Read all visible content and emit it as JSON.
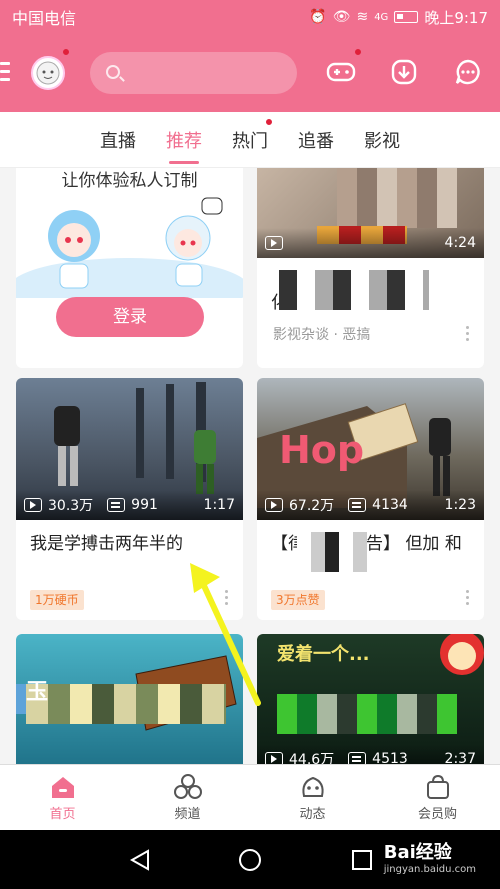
{
  "status_bar": {
    "carrier": "中国电信",
    "signal": "4G",
    "time": "晚上9:17"
  },
  "header": {
    "search_placeholder": "",
    "accent_color": "#f16f8f",
    "icons": [
      "menu-icon",
      "avatar",
      "search-icon",
      "game-icon",
      "download-icon",
      "message-icon"
    ]
  },
  "tabs": [
    {
      "label": "直播",
      "active": false
    },
    {
      "label": "推荐",
      "active": true
    },
    {
      "label": "热门",
      "active": false
    },
    {
      "label": "追番",
      "active": false
    },
    {
      "label": "影视",
      "active": false
    }
  ],
  "cards": {
    "login_card": {
      "title": "让你体验私人订制",
      "button_label": "登录"
    },
    "video_top_right": {
      "duration": "4:24",
      "title": "化",
      "sub": "影视杂谈 · 恶搞"
    },
    "video_fight": {
      "views": "30.3万",
      "danmaku": "991",
      "duration": "1:17",
      "title": "我是学搏击两年半的",
      "tag": "1万硬币"
    },
    "video_hop": {
      "overlay_text": "Hop",
      "views": "67.2万",
      "danmaku": "4134",
      "duration": "1:23",
      "title": "【律师 ... 警告】 但加 和",
      "tag": "3万点赞"
    },
    "video_bottom_left": {
      "title": "玉"
    },
    "video_bottom_right": {
      "overlay_text": "爱着一个...",
      "views": "44.6万",
      "danmaku": "4513",
      "duration": "2:37"
    }
  },
  "bottom_nav": [
    {
      "label": "首页",
      "active": true,
      "icon": "home-icon"
    },
    {
      "label": "频道",
      "active": false,
      "icon": "channel-icon"
    },
    {
      "label": "动态",
      "active": false,
      "icon": "dynamic-icon"
    },
    {
      "label": "会员购",
      "active": false,
      "icon": "shop-icon"
    }
  ],
  "watermark": {
    "brand": "Bai经验",
    "url": "jingyan.baidu.com"
  }
}
